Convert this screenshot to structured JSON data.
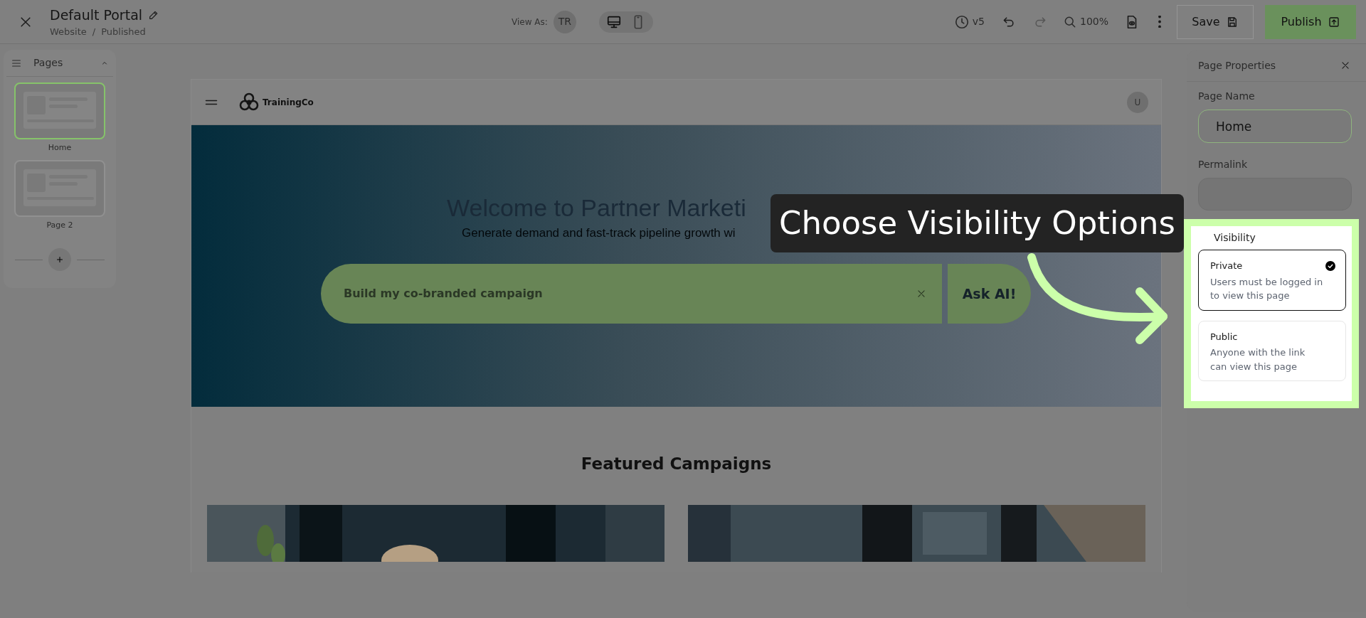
{
  "topbar": {
    "title": "Default Portal",
    "breadcrumb": [
      "Website",
      "Published"
    ],
    "breadcrumb_separator": "/",
    "view_as_label": "View As:",
    "view_as_avatar": "TR",
    "version": "v5",
    "zoom": "100%",
    "save": "Save",
    "publish": "Publish",
    "devices": [
      {
        "kind": "desktop",
        "selected": true
      },
      {
        "kind": "mobile",
        "selected": false
      }
    ]
  },
  "pages_panel": {
    "title": "Pages",
    "pages": [
      {
        "name": "Home",
        "selected": true
      },
      {
        "name": "Page 2",
        "selected": false
      }
    ]
  },
  "site": {
    "brand": "TrainingCo",
    "avatar": "U",
    "hero_title": "Welcome to Partner Marketi",
    "hero_subtitle": "Generate demand and fast-track pipeline growth wi",
    "search_value": "Build my co-branded campaign",
    "ask_button": "Ask AI!",
    "section_title": "Featured Campaigns"
  },
  "properties": {
    "title": "Page Properties",
    "page_name_label": "Page Name",
    "page_name_value": "Home",
    "permalink_label": "Permalink",
    "visibility_label": "Visibility",
    "options": [
      {
        "title": "Private",
        "description": "Users must be logged in to view this page",
        "selected": true
      },
      {
        "title": "Public",
        "description": "Anyone with the link can view this page",
        "selected": false
      }
    ]
  },
  "callout": {
    "text": "Choose Visibility Options"
  }
}
